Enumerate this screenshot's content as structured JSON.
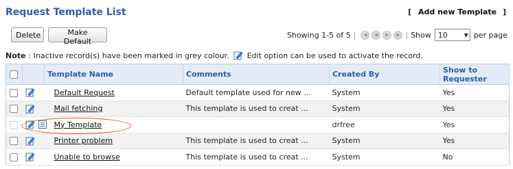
{
  "header": {
    "title": "Request Template List",
    "add_new_label": "Add new Template",
    "bracket_open": "[",
    "bracket_close": "]"
  },
  "toolbar": {
    "delete_label": "Delete",
    "make_default_label": "Make Default"
  },
  "pager": {
    "showing_text": "Showing 1-5 of 5",
    "separator": "|",
    "show_label": "Show",
    "per_page_value": "10",
    "per_page_label": "per page"
  },
  "note": {
    "label": "Note",
    "text_before": ": Inactive record(s) have been marked in grey colour.",
    "text_after": "Edit option can be used to activate the record."
  },
  "table": {
    "columns": [
      "Template Name",
      "Comments",
      "Created By",
      "Show to Requester"
    ],
    "rows": [
      {
        "name": "Default Request",
        "comments": "Default template used for new ...",
        "created_by": "System",
        "show": "Yes",
        "inactive": false
      },
      {
        "name": "Mail fetching",
        "comments": "This template is used to creat ...",
        "created_by": "System",
        "show": "Yes",
        "inactive": false
      },
      {
        "name": "My Template",
        "comments": "",
        "created_by": "drfree",
        "show": "Yes",
        "inactive": true
      },
      {
        "name": "Printer problem",
        "comments": "This template is used to creat ...",
        "created_by": "System",
        "show": "Yes",
        "inactive": false
      },
      {
        "name": "Unable to browse",
        "comments": "This template is used to creat ...",
        "created_by": "System",
        "show": "No",
        "inactive": false
      }
    ]
  },
  "colors": {
    "title": "#2b5fa6",
    "header_bg": "#e3ecf6",
    "highlight_circle": "#d9532f"
  }
}
